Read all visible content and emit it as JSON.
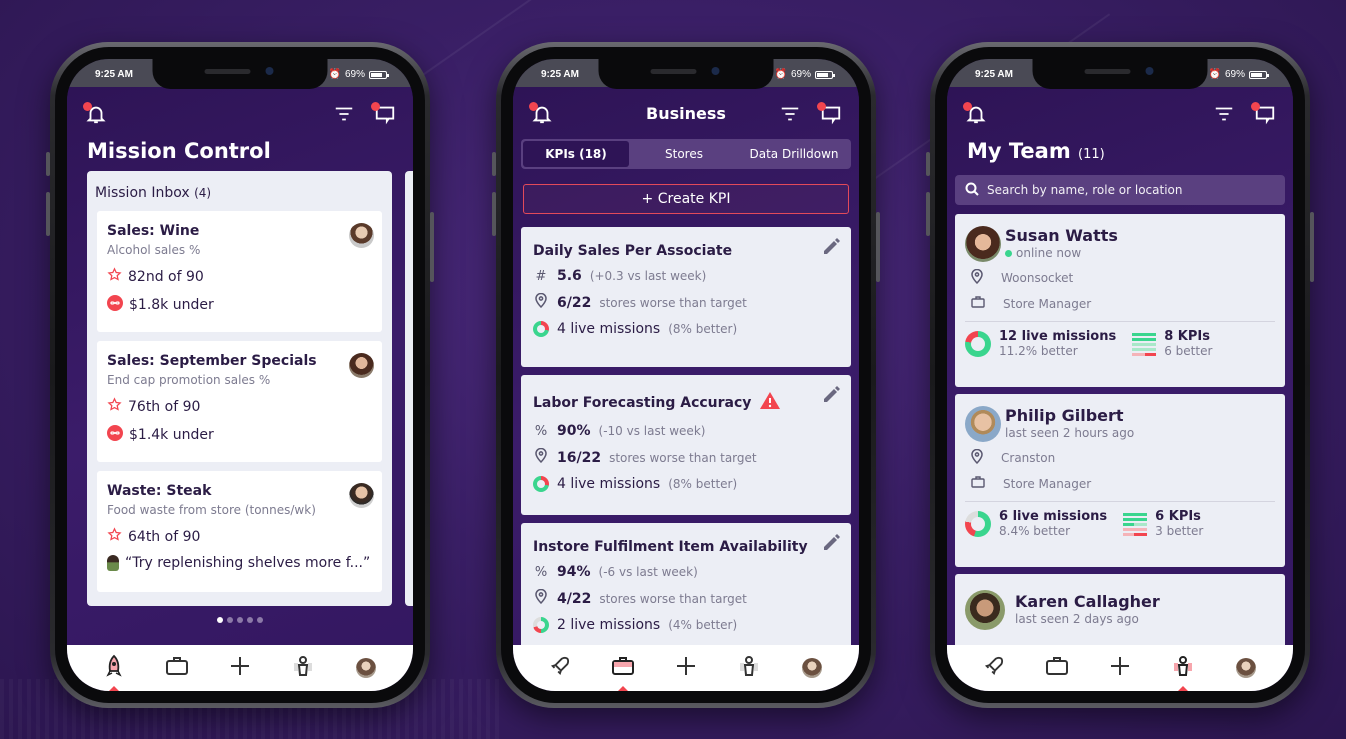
{
  "status_bar": {
    "time": "9:25 AM",
    "battery": "69%"
  },
  "phones": {
    "mission": {
      "title": "Mission Control",
      "inbox_title": "Mission Inbox",
      "inbox_count": "(4)",
      "cards": [
        {
          "title": "Sales: Wine",
          "subtitle": "Alcohol sales %",
          "rank": "82nd of 90",
          "detail": "$1.8k under",
          "detail_icon": "infinity-icon"
        },
        {
          "title": "Sales: September Specials",
          "subtitle": "End cap promotion sales %",
          "rank": "76th of 90",
          "detail": "$1.4k under",
          "detail_icon": "infinity-icon"
        },
        {
          "title": "Waste: Steak",
          "subtitle": "Food waste from store (tonnes/wk)",
          "rank": "64th of 90",
          "detail": "“Try replenishing shelves more f...”",
          "detail_icon": "comment-avatar"
        }
      ],
      "page_dots": {
        "total": 5,
        "active": 1
      },
      "active_tab": "missions"
    },
    "business": {
      "title": "Business",
      "tabs": [
        {
          "label": "KPIs (18)",
          "active": true
        },
        {
          "label": "Stores",
          "active": false
        },
        {
          "label": "Data Drilldown",
          "active": false
        }
      ],
      "create_label": "+ Create KPI",
      "kpis": [
        {
          "title": "Daily Sales Per Associate",
          "warning": false,
          "metric_icon": "#",
          "value": "5.6",
          "delta": "(+0.3 vs last week)",
          "stores": "6/22",
          "stores_label": "stores worse than target",
          "missions": "4 live missions",
          "missions_note": "(8% better)"
        },
        {
          "title": "Labor Forecasting Accuracy",
          "warning": true,
          "metric_icon": "%",
          "value": "90%",
          "delta": "(-10 vs last week)",
          "stores": "16/22",
          "stores_label": "stores worse than target",
          "missions": "4 live missions",
          "missions_note": "(8% better)"
        },
        {
          "title": "Instore Fulfilment Item Availability",
          "warning": false,
          "metric_icon": "%",
          "value": "94%",
          "delta": "(-6 vs last week)",
          "stores": "4/22",
          "stores_label": "stores worse than target",
          "missions": "2 live missions",
          "missions_note": "(4% better)"
        }
      ],
      "active_tab": "business"
    },
    "team": {
      "title": "My Team",
      "count": "(11)",
      "search_placeholder": "Search by name, role or location",
      "members": [
        {
          "name": "Susan Watts",
          "status": "online now",
          "online": true,
          "location": "Woonsocket",
          "role": "Store Manager",
          "missions": "12 live missions",
          "missions_better": "11.2% better",
          "kpis": "8 KPIs",
          "kpis_better": "6 better"
        },
        {
          "name": "Philip Gilbert",
          "status": "last seen 2 hours ago",
          "online": false,
          "location": "Cranston",
          "role": "Store Manager",
          "missions": "6 live missions",
          "missions_better": "8.4% better",
          "kpis": "6 KPIs",
          "kpis_better": "3 better"
        },
        {
          "name": "Karen Callagher",
          "status": "last seen 2 days ago",
          "online": false
        }
      ],
      "active_tab": "team"
    }
  },
  "colors": {
    "accent": "#f2454f",
    "success": "#3ad58e",
    "primary_bg": "#2e1456",
    "card_bg": "#eceef5",
    "text_dark": "#2b1c45"
  }
}
